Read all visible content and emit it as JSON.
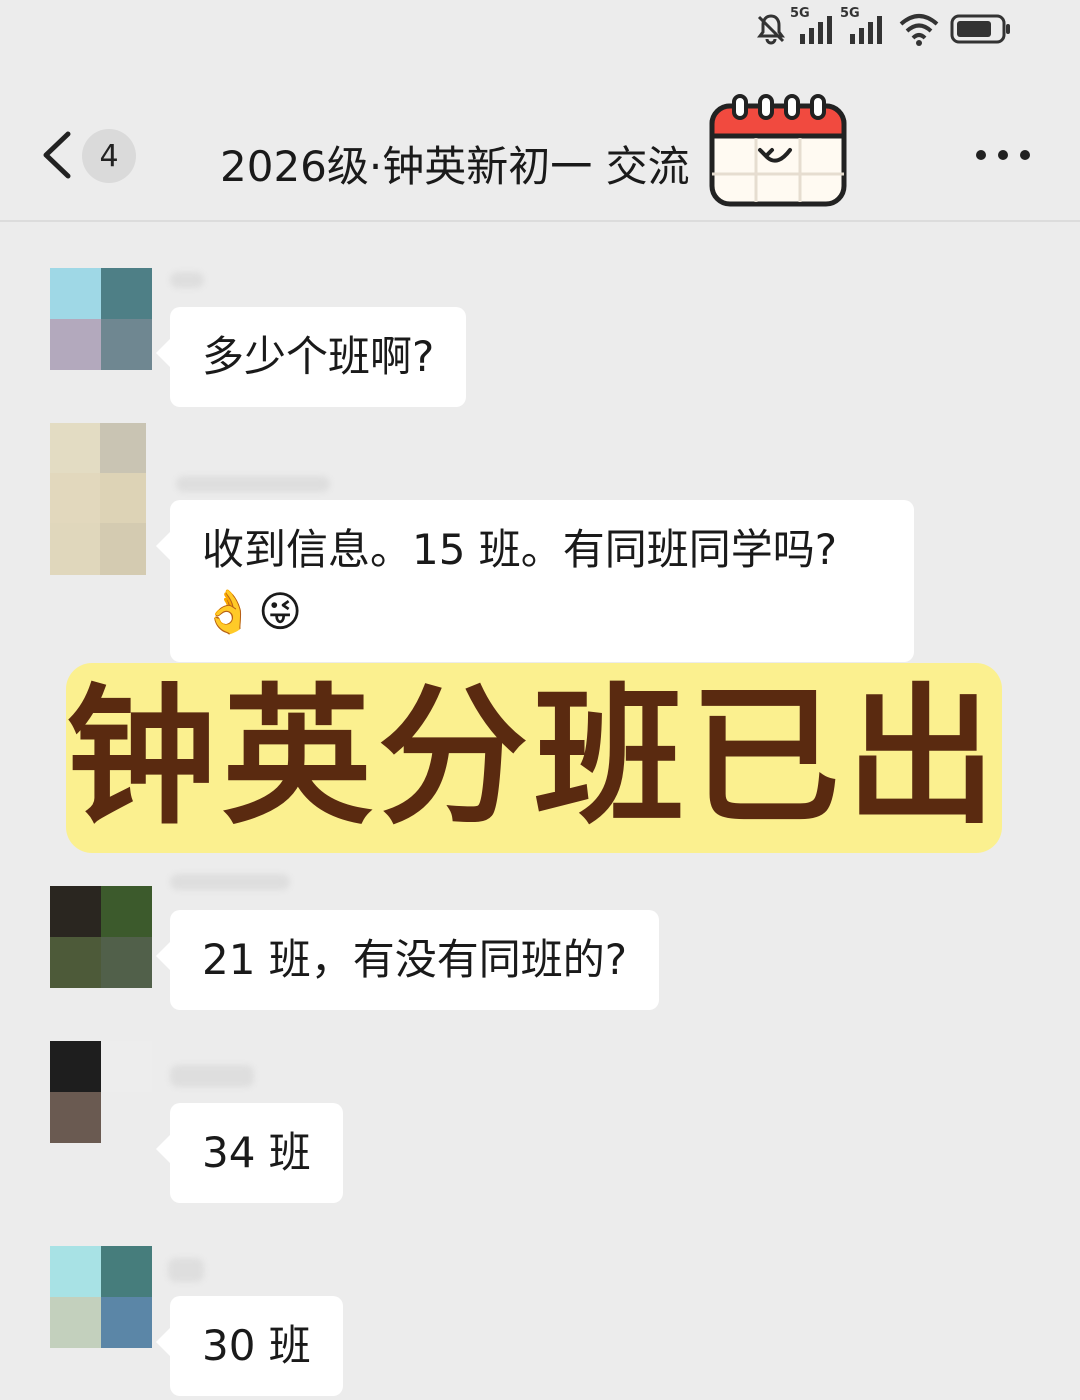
{
  "status_bar": {
    "icons": [
      "mute-bell-icon",
      "signal-5g-icon",
      "signal-5g-icon",
      "wifi-icon",
      "battery-icon"
    ],
    "network_labels": [
      "5G",
      "5G"
    ]
  },
  "header": {
    "back_icon": "chevron-left-icon",
    "unread_count": "4",
    "title": "2026级·钟英新初一 交流",
    "more_icon": "more-dots-icon",
    "sticker_icon": "calendar-smile-icon"
  },
  "messages": [
    {
      "text": "多少个班啊?",
      "emoji": []
    },
    {
      "text": "收到信息。15 班。有同班同学吗?",
      "emoji": [
        "👌",
        "😜"
      ]
    },
    {
      "text": "21 班，有没有同班的?",
      "emoji": []
    },
    {
      "text": "34 班",
      "emoji": []
    },
    {
      "text": "30 班",
      "emoji": []
    }
  ],
  "overlay": {
    "text": "钟英分班已出"
  },
  "colors": {
    "background": "#ececec",
    "bubble": "#ffffff",
    "overlay_bg": "#fbf08f",
    "overlay_text": "#5a2a10",
    "calendar_red": "#f14a3f"
  }
}
